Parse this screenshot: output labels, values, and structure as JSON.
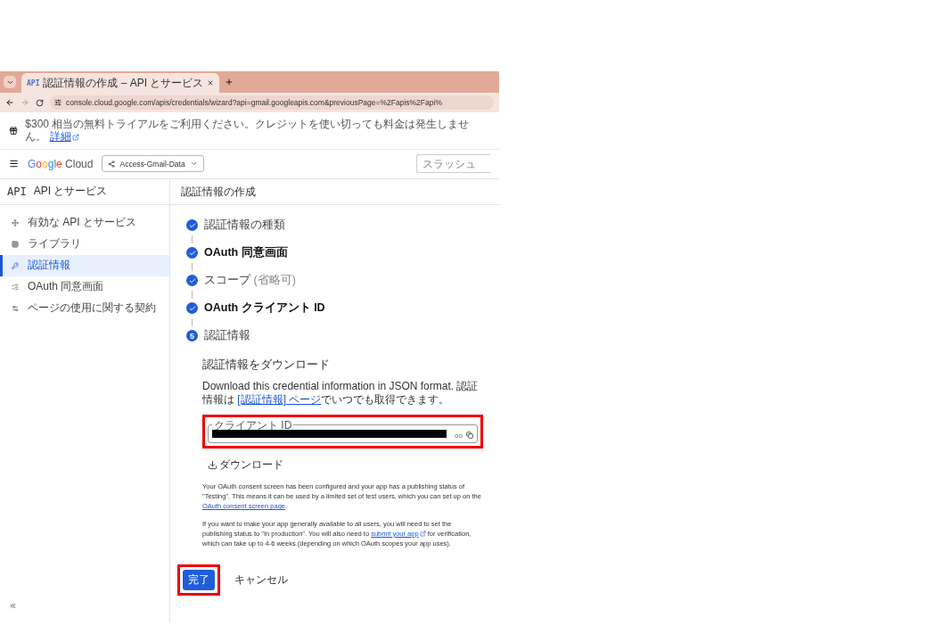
{
  "browser": {
    "tab": {
      "favicon": "API",
      "title": "認証情報の作成 – API とサービス",
      "selected": true
    },
    "url": "console.cloud.google.com/apis/credentials/wizard?api=gmail.googleapis.com&previousPage=%2Fapis%2Fapi%"
  },
  "banner": {
    "text": "$300 相当の無料トライアルをご利用ください。クレジットを使い切っても料金は発生しません。",
    "link": "詳細"
  },
  "header": {
    "logo": {
      "brand": "Google",
      "product": "Cloud"
    },
    "project": "Access-Gmail-Data",
    "search": {
      "placeholder": "スラッシュ"
    }
  },
  "sidebar": {
    "badge": "API",
    "title": "API とサービス",
    "items": [
      {
        "label": "有効な API とサービス",
        "kind": "services",
        "selected": false
      },
      {
        "label": "ライブラリ",
        "kind": "library",
        "selected": false
      },
      {
        "label": "認証情報",
        "kind": "key",
        "selected": true
      },
      {
        "label": "OAuth 同意画面",
        "kind": "consent",
        "selected": false
      },
      {
        "label": "ページの使用に関する契約",
        "kind": "agreements",
        "selected": false
      }
    ]
  },
  "page_title": "認証情報の作成",
  "steps": [
    {
      "label": "認証情報の種類",
      "kind": "done",
      "emphasized": false
    },
    {
      "label": "OAuth 同意画面",
      "kind": "done",
      "emphasized": true
    },
    {
      "label": "スコープ",
      "note": "(省略可)",
      "kind": "done",
      "emphasized": false
    },
    {
      "label": "OAuth クライアント ID",
      "kind": "done",
      "emphasized": true
    },
    {
      "label": "認証情報",
      "number": "5",
      "kind": "current",
      "emphasized": false
    }
  ],
  "download": {
    "heading": "認証情報をダウンロード",
    "intro": "Download this credential information in JSON format. 認証情報は ",
    "intro_link": "[認証情報] ページ",
    "intro_end": "でいつでも取得できます。",
    "client_id": {
      "label": "クライアント ID",
      "value": "oo",
      "redacted": true
    },
    "button": "ダウンロード",
    "para1": "Your OAuth consent screen has been configured and your app has a publishing status of \"Testing\". This means it can be used by a limited set of test users, which you can set up on the ",
    "para1_link": "OAuth consent screen page",
    "para1_end": ".",
    "para2": "If you want to make your app generally available to all users, you will need to set the publishing status to \"In production\". You will also need to ",
    "para2_link": "submit your app",
    "para2_end": " for verification, which can take up to 4-6 weeks (depending on which OAuth scopes your app uses)."
  },
  "actions": {
    "primary": "完了",
    "secondary": "キャンセル"
  }
}
